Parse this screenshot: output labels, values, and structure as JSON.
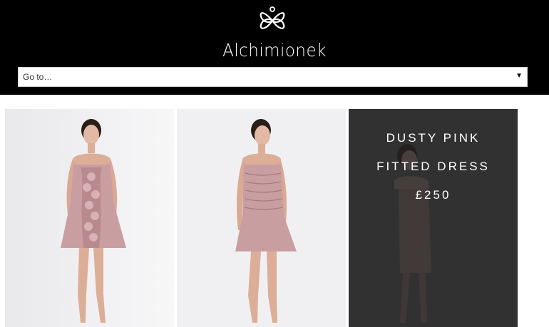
{
  "header": {
    "brand_name": "Alchimionek",
    "logo_icon": "interlocked-loops-logo-icon"
  },
  "nav": {
    "select_label": "Go to…",
    "caret": "▼"
  },
  "gallery": {
    "items": [
      {
        "alt": "pink ruffled strapless dress"
      },
      {
        "alt": "pink ruched strapless dress"
      },
      {
        "title_line1": "DUSTY PINK",
        "title_line2": "FITTED DRESS",
        "price": "£250"
      }
    ]
  },
  "colors": {
    "header_bg": "#000000",
    "dress_pink": "#c99ea1",
    "overlay": "#3d3d3f"
  }
}
